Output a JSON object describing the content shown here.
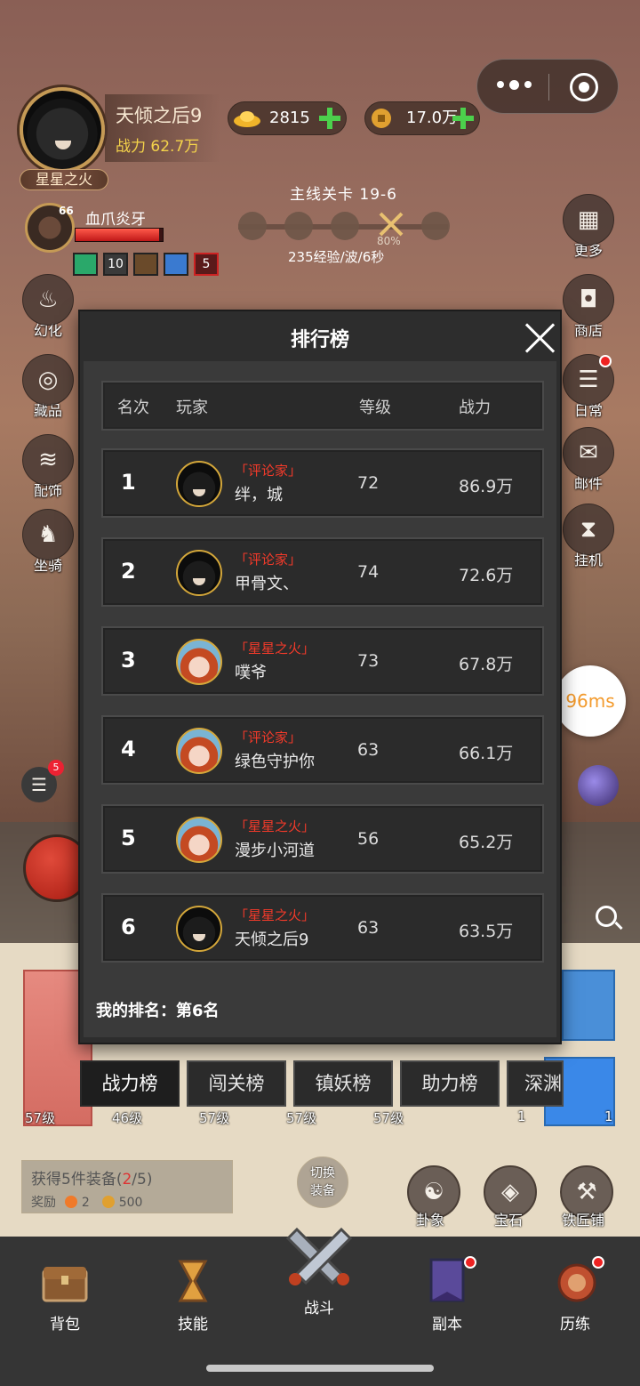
{
  "header": {
    "player_name": "天倾之后9",
    "player_power": "战力 62.7万",
    "player_title": "星星之火",
    "gold_ingot": "2815",
    "copper_coin": "17.0万"
  },
  "pet": {
    "level": "66",
    "name": "血爪炎牙",
    "hp_fraction": 0.96,
    "buffs": [
      "",
      "10",
      "",
      "",
      "5"
    ]
  },
  "stage": {
    "title": "主线关卡 19-6",
    "progress_pct": "80%",
    "info": "235经验/波/6秒"
  },
  "left_menu": [
    "幻化",
    "藏品",
    "配饰",
    "坐骑"
  ],
  "right_menu": [
    "更多",
    "商店",
    "日常",
    "邮件",
    "挂机"
  ],
  "ping": "96ms",
  "modal": {
    "title": "排行榜",
    "headers": [
      "名次",
      "玩家",
      "等级",
      "战力"
    ],
    "rows": [
      {
        "rank": "1",
        "tag": "「评论家」",
        "name": "绊，城",
        "level": "72",
        "power": "86.9万",
        "avatar": "hood"
      },
      {
        "rank": "2",
        "tag": "「评论家」",
        "name": "甲骨文、",
        "level": "74",
        "power": "72.6万",
        "avatar": "hood"
      },
      {
        "rank": "3",
        "tag": "「星星之火」",
        "name": "噗爷",
        "level": "73",
        "power": "67.8万",
        "avatar": "girl"
      },
      {
        "rank": "4",
        "tag": "「评论家」",
        "name": "绿色守护你",
        "level": "63",
        "power": "66.1万",
        "avatar": "girl"
      },
      {
        "rank": "5",
        "tag": "「星星之火」",
        "name": "漫步小河道",
        "level": "56",
        "power": "65.2万",
        "avatar": "girl"
      },
      {
        "rank": "6",
        "tag": "「星星之火」",
        "name": "天倾之后9",
        "level": "63",
        "power": "63.5万",
        "avatar": "hood"
      }
    ],
    "my_rank": "我的排名：第6名"
  },
  "tabs": [
    "战力榜",
    "闯关榜",
    "镇妖榜",
    "助力榜",
    "深渊"
  ],
  "equip_levels": [
    "57级",
    "46级",
    "57级",
    "57级",
    "57级"
  ],
  "right_counts": [
    "1",
    "1"
  ],
  "chat_badge": "5",
  "quest": {
    "line1_prefix": "获得5件装备(",
    "line1_count": "2",
    "line1_suffix": "/5)",
    "reward_label": "奖励",
    "reward_a": "2",
    "reward_b": "500"
  },
  "switch_label": "切换\n装备",
  "tools": [
    "卦象",
    "宝石",
    "铁匠铺"
  ],
  "bottom_nav": [
    "背包",
    "技能",
    "战斗",
    "副本",
    "历练"
  ],
  "colors": {
    "accent_red": "#f23a2a",
    "ping_orange": "#f39a2c",
    "power_yellow": "#f4d34a"
  }
}
